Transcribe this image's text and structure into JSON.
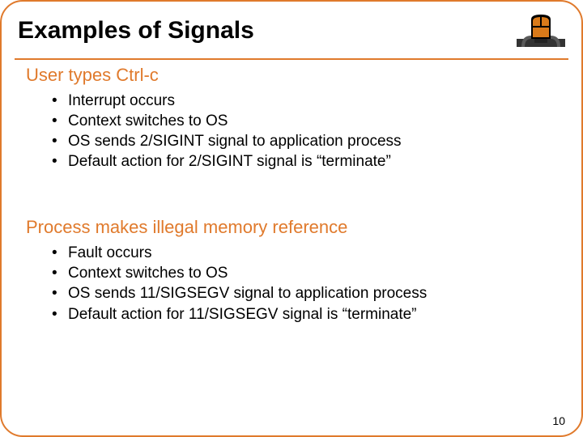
{
  "title": "Examples of Signals",
  "sections": [
    {
      "heading": "User types Ctrl-c",
      "items": [
        "Interrupt occurs",
        "Context switches to OS",
        "OS sends 2/SIGINT signal to application process",
        "Default action for 2/SIGINT signal is “terminate”"
      ]
    },
    {
      "heading": "Process makes illegal memory reference",
      "items": [
        "Fault occurs",
        "Context switches to OS",
        "OS sends 11/SIGSEGV signal to application process",
        "Default action for 11/SIGSEGV signal is “terminate”"
      ]
    }
  ],
  "page_number": "10"
}
